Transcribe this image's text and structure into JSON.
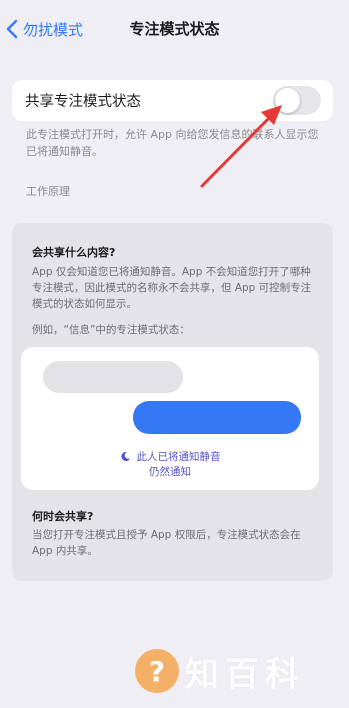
{
  "nav": {
    "back_label": "勿扰模式",
    "title": "专注模式状态"
  },
  "share_toggle": {
    "label": "共享专注模式状态",
    "enabled": false
  },
  "footnote": "此专注模式打开时，允许 App 向给您发信息的联系人显示您已将通知静音。",
  "how_it_works": "工作原理",
  "info_card": {
    "what_heading": "会共享什么内容?",
    "what_body": "App 仅会知道您已将通知静音。App 不会知道您打开了哪种专注模式，因此模式的名称永不会共享，但 App 可控制专注模式的状态如何显示。",
    "example_label": "例如，“信息”中的专注模式状态：",
    "preview": {
      "status_line1": "此人已将通知静音",
      "status_line2": "仍然通知"
    },
    "when_heading": "何时会共享?",
    "when_body": "当您打开专注模式且授予 App 权限后，专注模式状态会在 App 内共享。"
  },
  "colors": {
    "accent": "#3478f6",
    "focus_purple": "#5753c8",
    "arrow_red": "#e53935"
  },
  "watermark": {
    "icon_char": "?",
    "text": "知百科"
  }
}
